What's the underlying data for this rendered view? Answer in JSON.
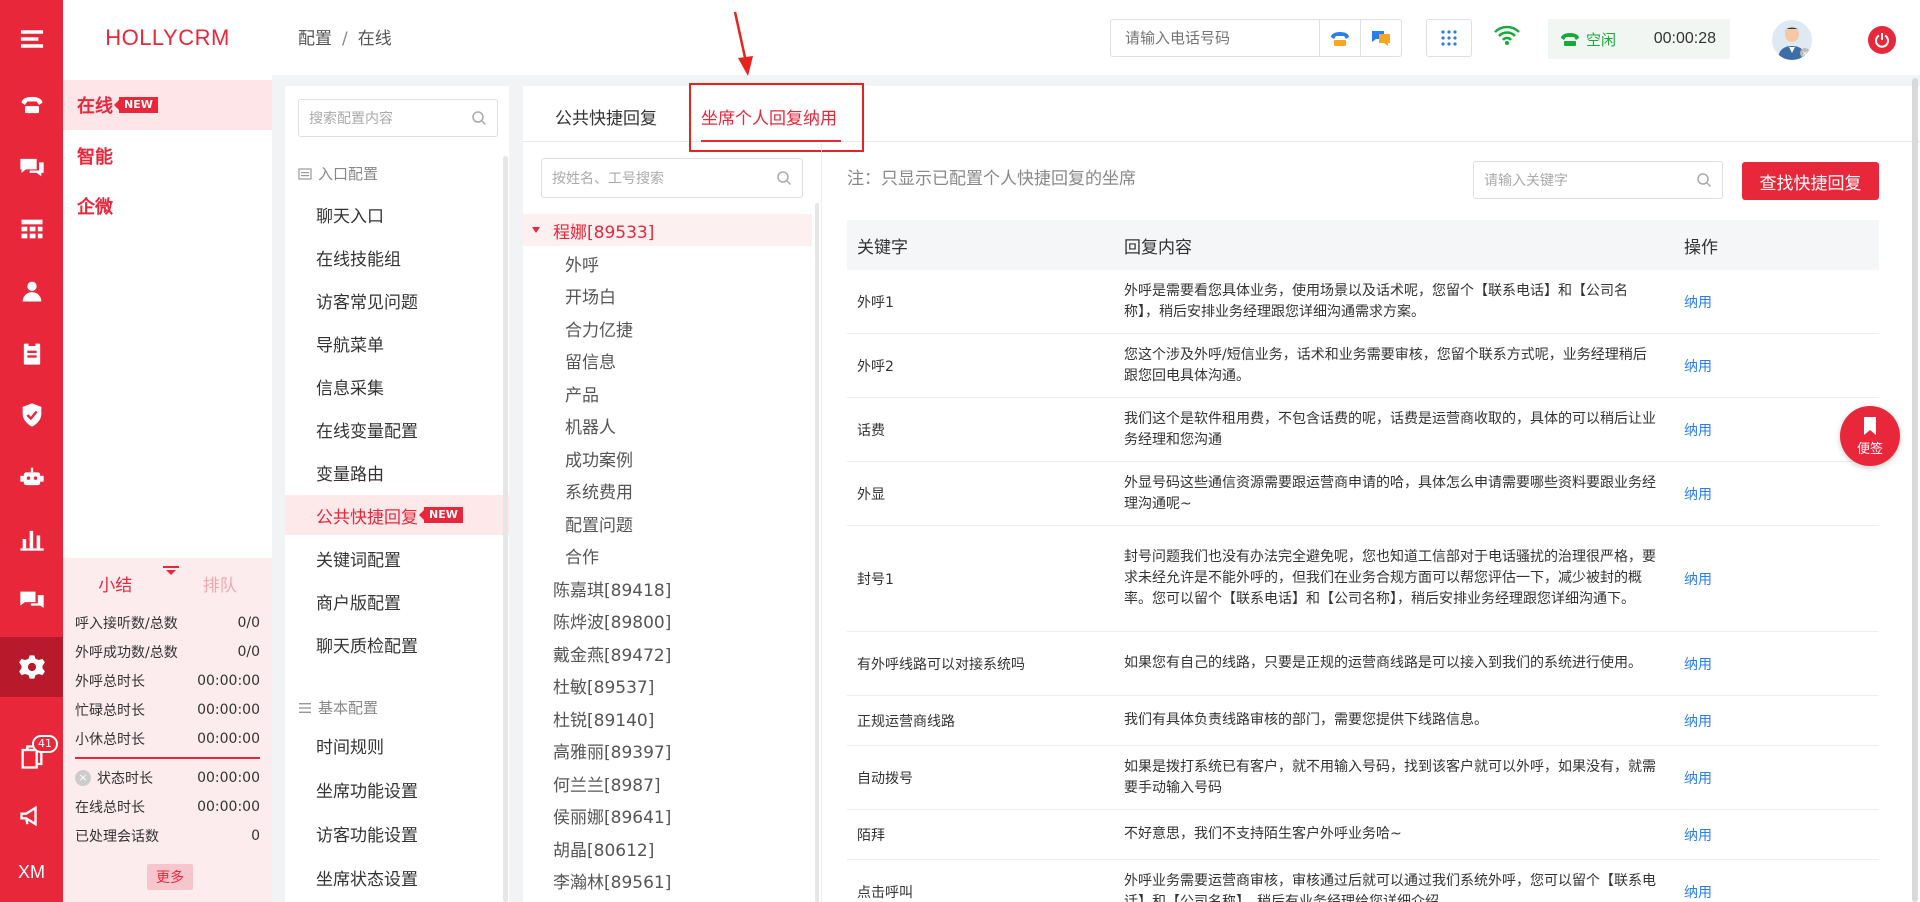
{
  "app": {
    "logo": "HOLLYCRM"
  },
  "rail": {
    "items": [
      {
        "icon": "menu-icon"
      },
      {
        "icon": "phone-icon"
      },
      {
        "icon": "chat-icon"
      },
      {
        "icon": "dashboard-grid-icon"
      },
      {
        "icon": "user-icon"
      },
      {
        "icon": "clipboard-icon"
      },
      {
        "icon": "shield-icon"
      },
      {
        "icon": "robot-icon"
      },
      {
        "icon": "bar-chart-icon"
      },
      {
        "icon": "message-icon"
      },
      {
        "icon": "gear-icon",
        "active": true
      },
      {
        "icon": "book-icon",
        "badge": "41"
      },
      {
        "icon": "megaphone-icon"
      }
    ],
    "bottom_label": "XM"
  },
  "subnav": {
    "items": [
      {
        "label": "在线",
        "badge": "NEW",
        "active": true
      },
      {
        "label": "智能"
      },
      {
        "label": "企微"
      }
    ]
  },
  "stats": {
    "tab_active": "小结",
    "tab_inactive": "排队",
    "rows": [
      {
        "label": "呼入接听数/总数",
        "value": "0/0"
      },
      {
        "label": "外呼成功数/总数",
        "value": "0/0"
      },
      {
        "label": "外呼总时长",
        "value": "00:00:00"
      },
      {
        "label": "忙碌总时长",
        "value": "00:00:00"
      },
      {
        "label": "小休总时长",
        "value": "00:00:00"
      }
    ],
    "rows2": [
      {
        "label": "状态时长",
        "value": "00:00:00"
      },
      {
        "label": "在线总时长",
        "value": "00:00:00"
      },
      {
        "label": "已处理会话数",
        "value": "0"
      }
    ],
    "more": "更多"
  },
  "header": {
    "breadcrumb": [
      "配置",
      "在线"
    ],
    "breadcrumb_sep": "/",
    "phone_placeholder": "请输入电话号码",
    "status": "空闲",
    "timer": "00:00:28"
  },
  "config": {
    "search_placeholder": "搜索配置内容",
    "group1": "入口配置",
    "group1_items": [
      "聊天入口",
      "在线技能组",
      "访客常见问题",
      "导航菜单",
      "信息采集",
      "在线变量配置",
      "变量路由",
      "公共快捷回复",
      "关键词配置",
      "商户版配置",
      "聊天质检配置"
    ],
    "active_item": "公共快捷回复",
    "active_badge": "NEW",
    "group2": "基本配置",
    "group2_items": [
      "时间规则",
      "坐席功能设置",
      "访客功能设置",
      "坐席状态设置"
    ]
  },
  "main": {
    "tabs": [
      "公共快捷回复",
      "坐席个人回复纳用"
    ],
    "active_tab": 1,
    "agent_search_placeholder": "按姓名、工号搜索",
    "selected_agent": "程娜[89533]",
    "selected_agent_children": [
      "外呼",
      "开场白",
      "合力亿捷",
      "留信息",
      "产品",
      "机器人",
      "成功案例",
      "系统费用",
      "配置问题",
      "合作"
    ],
    "agents": [
      "陈嘉琪[89418]",
      "陈烨波[89800]",
      "戴金燕[89472]",
      "杜敏[89537]",
      "杜锐[89140]",
      "高雅丽[89397]",
      "何兰兰[8987]",
      "侯丽娜[89641]",
      "胡晶[80612]",
      "李瀚林[89561]"
    ],
    "note": "注：只显示已配置个人快捷回复的坐席",
    "keyword_placeholder": "请输入关键字",
    "find_button": "查找快捷回复",
    "table_headers": [
      "关键字",
      "回复内容",
      "操作"
    ],
    "rows": [
      {
        "keyword": "外呼1",
        "content": "外呼是需要看您具体业务，使用场景以及话术呢，您留个【联系电话】和【公司名称】，稍后安排业务经理跟您详细沟通需求方案。",
        "action": "纳用"
      },
      {
        "keyword": "外呼2",
        "content": "您这个涉及外呼/短信业务，话术和业务需要审核，您留个联系方式呢，业务经理稍后跟您回电具体沟通。",
        "action": "纳用"
      },
      {
        "keyword": "话费",
        "content": "我们这个是软件租用费，不包含话费的呢，话费是运营商收取的，具体的可以稍后让业务经理和您沟通",
        "action": "纳用"
      },
      {
        "keyword": "外显",
        "content": "外显号码这些通信资源需要跟运营商申请的哈，具体怎么申请需要哪些资料要跟业务经理沟通呢~",
        "action": "纳用"
      },
      {
        "keyword": "封号1",
        "content": "封号问题我们也没有办法完全避免呢，您也知道工信部对于电话骚扰的治理很严格，要求未经允许是不能外呼的，但我们在业务合规方面可以帮您评估一下，减少被封的概率。您可以留个【联系电话】和【公司名称】，稍后安排业务经理跟您详细沟通下。",
        "action": "纳用"
      },
      {
        "keyword": "有外呼线路可以对接系统吗",
        "content": "如果您有自己的线路，只要是正规的运营商线路是可以接入到我们的系统进行使用。",
        "action": "纳用"
      },
      {
        "keyword": "正规运营商线路",
        "content": "我们有具体负责线路审核的部门，需要您提供下线路信息。",
        "action": "纳用"
      },
      {
        "keyword": "自动拨号",
        "content": "如果是拨打系统已有客户，就不用输入号码，找到该客户就可以外呼，如果没有，就需要手动输入号码",
        "action": "纳用"
      },
      {
        "keyword": "陌拜",
        "content": "不好意思，我们不支持陌生客户外呼业务哈~",
        "action": "纳用"
      },
      {
        "keyword": "点击呼叫",
        "content": "外呼业务需要运营商审核，审核通过后就可以通过我们系统外呼，您可以留个【联系电话】和【公司名称】，稍后有业务经理给您详细介绍",
        "action": "纳用"
      }
    ],
    "memo": "便签"
  },
  "colors": {
    "brand": "#e8273b",
    "link": "#2b7de9",
    "idle": "#19a83a"
  }
}
